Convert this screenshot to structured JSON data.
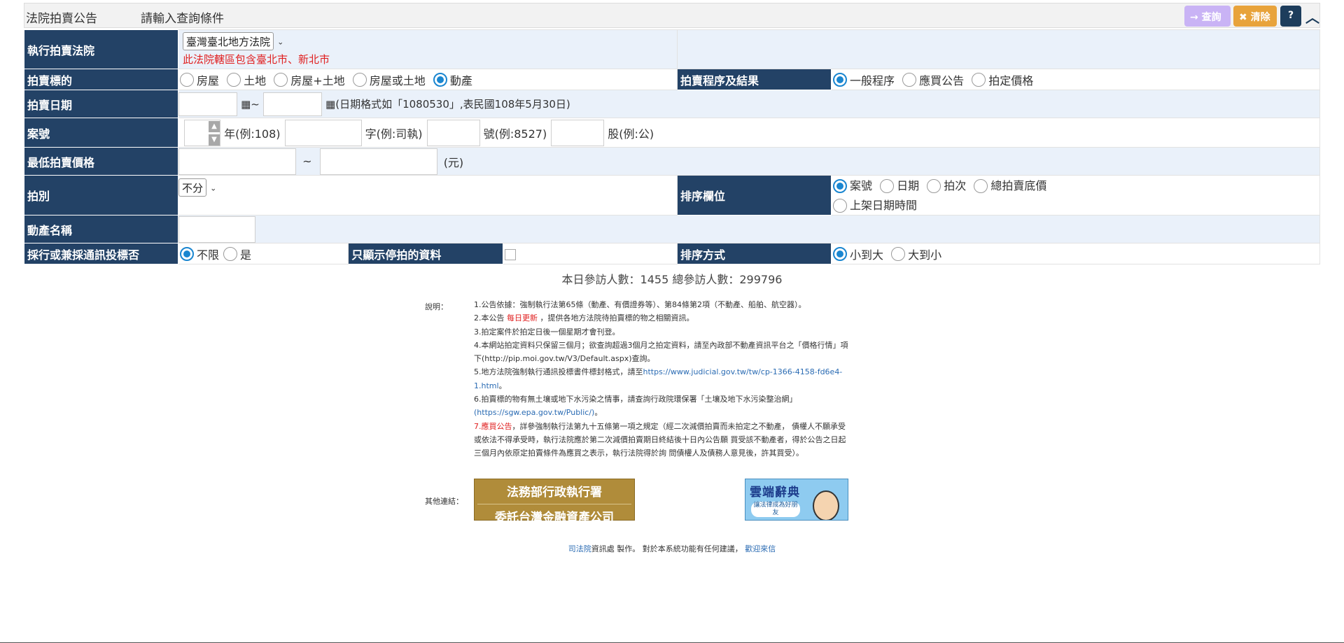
{
  "header": {
    "title": "法院拍賣公告",
    "subtitle": "請輸入查詢條件",
    "query_button": "→ 查詢",
    "clear_button": "✖ 清除",
    "help_button": "?",
    "collapse_icon": "chevron-up-icon"
  },
  "form": {
    "court": {
      "label": "執行拍賣法院",
      "selected": "臺灣臺北地方法院",
      "note": "此法院轄區包含臺北市、新北市"
    },
    "target": {
      "label": "拍賣標的",
      "options": [
        "房屋",
        "土地",
        "房屋+土地",
        "房屋或土地",
        "動產"
      ],
      "selected": "動產"
    },
    "procedure": {
      "label": "拍賣程序及結果",
      "options": [
        "一般程序",
        "應買公告",
        "拍定價格"
      ],
      "selected": "一般程序"
    },
    "date": {
      "label": "拍賣日期",
      "separator": "~",
      "hint": "(日期格式如「1080530」,表民國108年5月30日)"
    },
    "case_no": {
      "label": "案號",
      "year_suffix": "年(例:108)",
      "word_suffix": "字(例:司執)",
      "number_suffix": "號(例:8527)",
      "unit_suffix": "股(例:公)"
    },
    "min_price": {
      "label": "最低拍賣價格",
      "separator": "~",
      "unit": "(元)"
    },
    "round": {
      "label": "拍別",
      "selected": "不分"
    },
    "sort_field": {
      "label": "排序欄位",
      "options": [
        "案號",
        "日期",
        "拍次",
        "總拍賣底價",
        "上架日期時間"
      ],
      "selected": "案號"
    },
    "item_name": {
      "label": "動產名稱"
    },
    "telecom": {
      "label": "採行或兼採通訊投標否",
      "options": [
        "不限",
        "是"
      ],
      "selected": "不限"
    },
    "stopped_only": {
      "label": "只顯示停拍的資料"
    },
    "sort_order": {
      "label": "排序方式",
      "options": [
        "小到大",
        "大到小"
      ],
      "selected": "小到大"
    }
  },
  "visits": {
    "text": "本日參訪人數：1455  總參訪人數：299796"
  },
  "notes": {
    "label": "說明：",
    "lines": [
      "1.公告依據：強制執行法第65條（動產、有價證券等）、第84條第2項（不動產、船舶、航空器）。",
      "2.本公告",
      "每日更新",
      "，提供各地方法院待拍賣標的物之相關資訊。",
      "3.拍定案件於拍定日後一個星期才會刊登。",
      "4.本網站拍定資料只保留三個月；欲查詢超過3個月之拍定資料，請至內政部不動產資訊平台之「價格行情」項",
      "下(http://pip.moi.gov.tw/V3/Default.aspx)查詢。",
      "5.地方法院強制執行通訊投標書件標封格式，請至",
      "https://www.judicial.gov.tw/tw/cp-1366-4158-fd6e4-",
      "1.html",
      "。",
      "6.拍賣標的物有無土壤或地下水污染之情事，請查詢行政院環保署「土壤及地下水污染整治網」",
      "(https://sgw.epa.gov.tw/Public/)",
      "。",
      "7.",
      "應買公告",
      "，詳參強制執行法第九十五條第一項之規定（經二次減價拍賣而未拍定之不動產， 債權人不願承受",
      "或依法不得承受時，執行法院應於第二次減價拍賣期日終結後十日內公告願 買受該不動產者，得於公告之日起",
      "三個月內依原定拍賣條件為應買之表示，執行法院得於詢 問債權人及債務人意見後，許其買受）。"
    ]
  },
  "links": {
    "label": "其他連結：",
    "banner1_line1": "法務部行政執行署",
    "banner1_line2": "委託台灣金融資產公司",
    "banner2_title": "雲端辭典",
    "banner2_sub": "讓法律成為好朋友"
  },
  "footer": {
    "org": "司法院",
    "text1": "資訊處 製作。 對於本系統功能有任何建議，",
    "contact": "歡迎來信"
  },
  "colors": {
    "label_bg": "#234266",
    "shade_bg": "#eaf1fa",
    "radio_on": "#1a86d0",
    "query_btn": "#c9b3f5",
    "clear_btn": "#e8a33b",
    "help_btn": "#1d3d5c",
    "red_text": "#e02020"
  }
}
